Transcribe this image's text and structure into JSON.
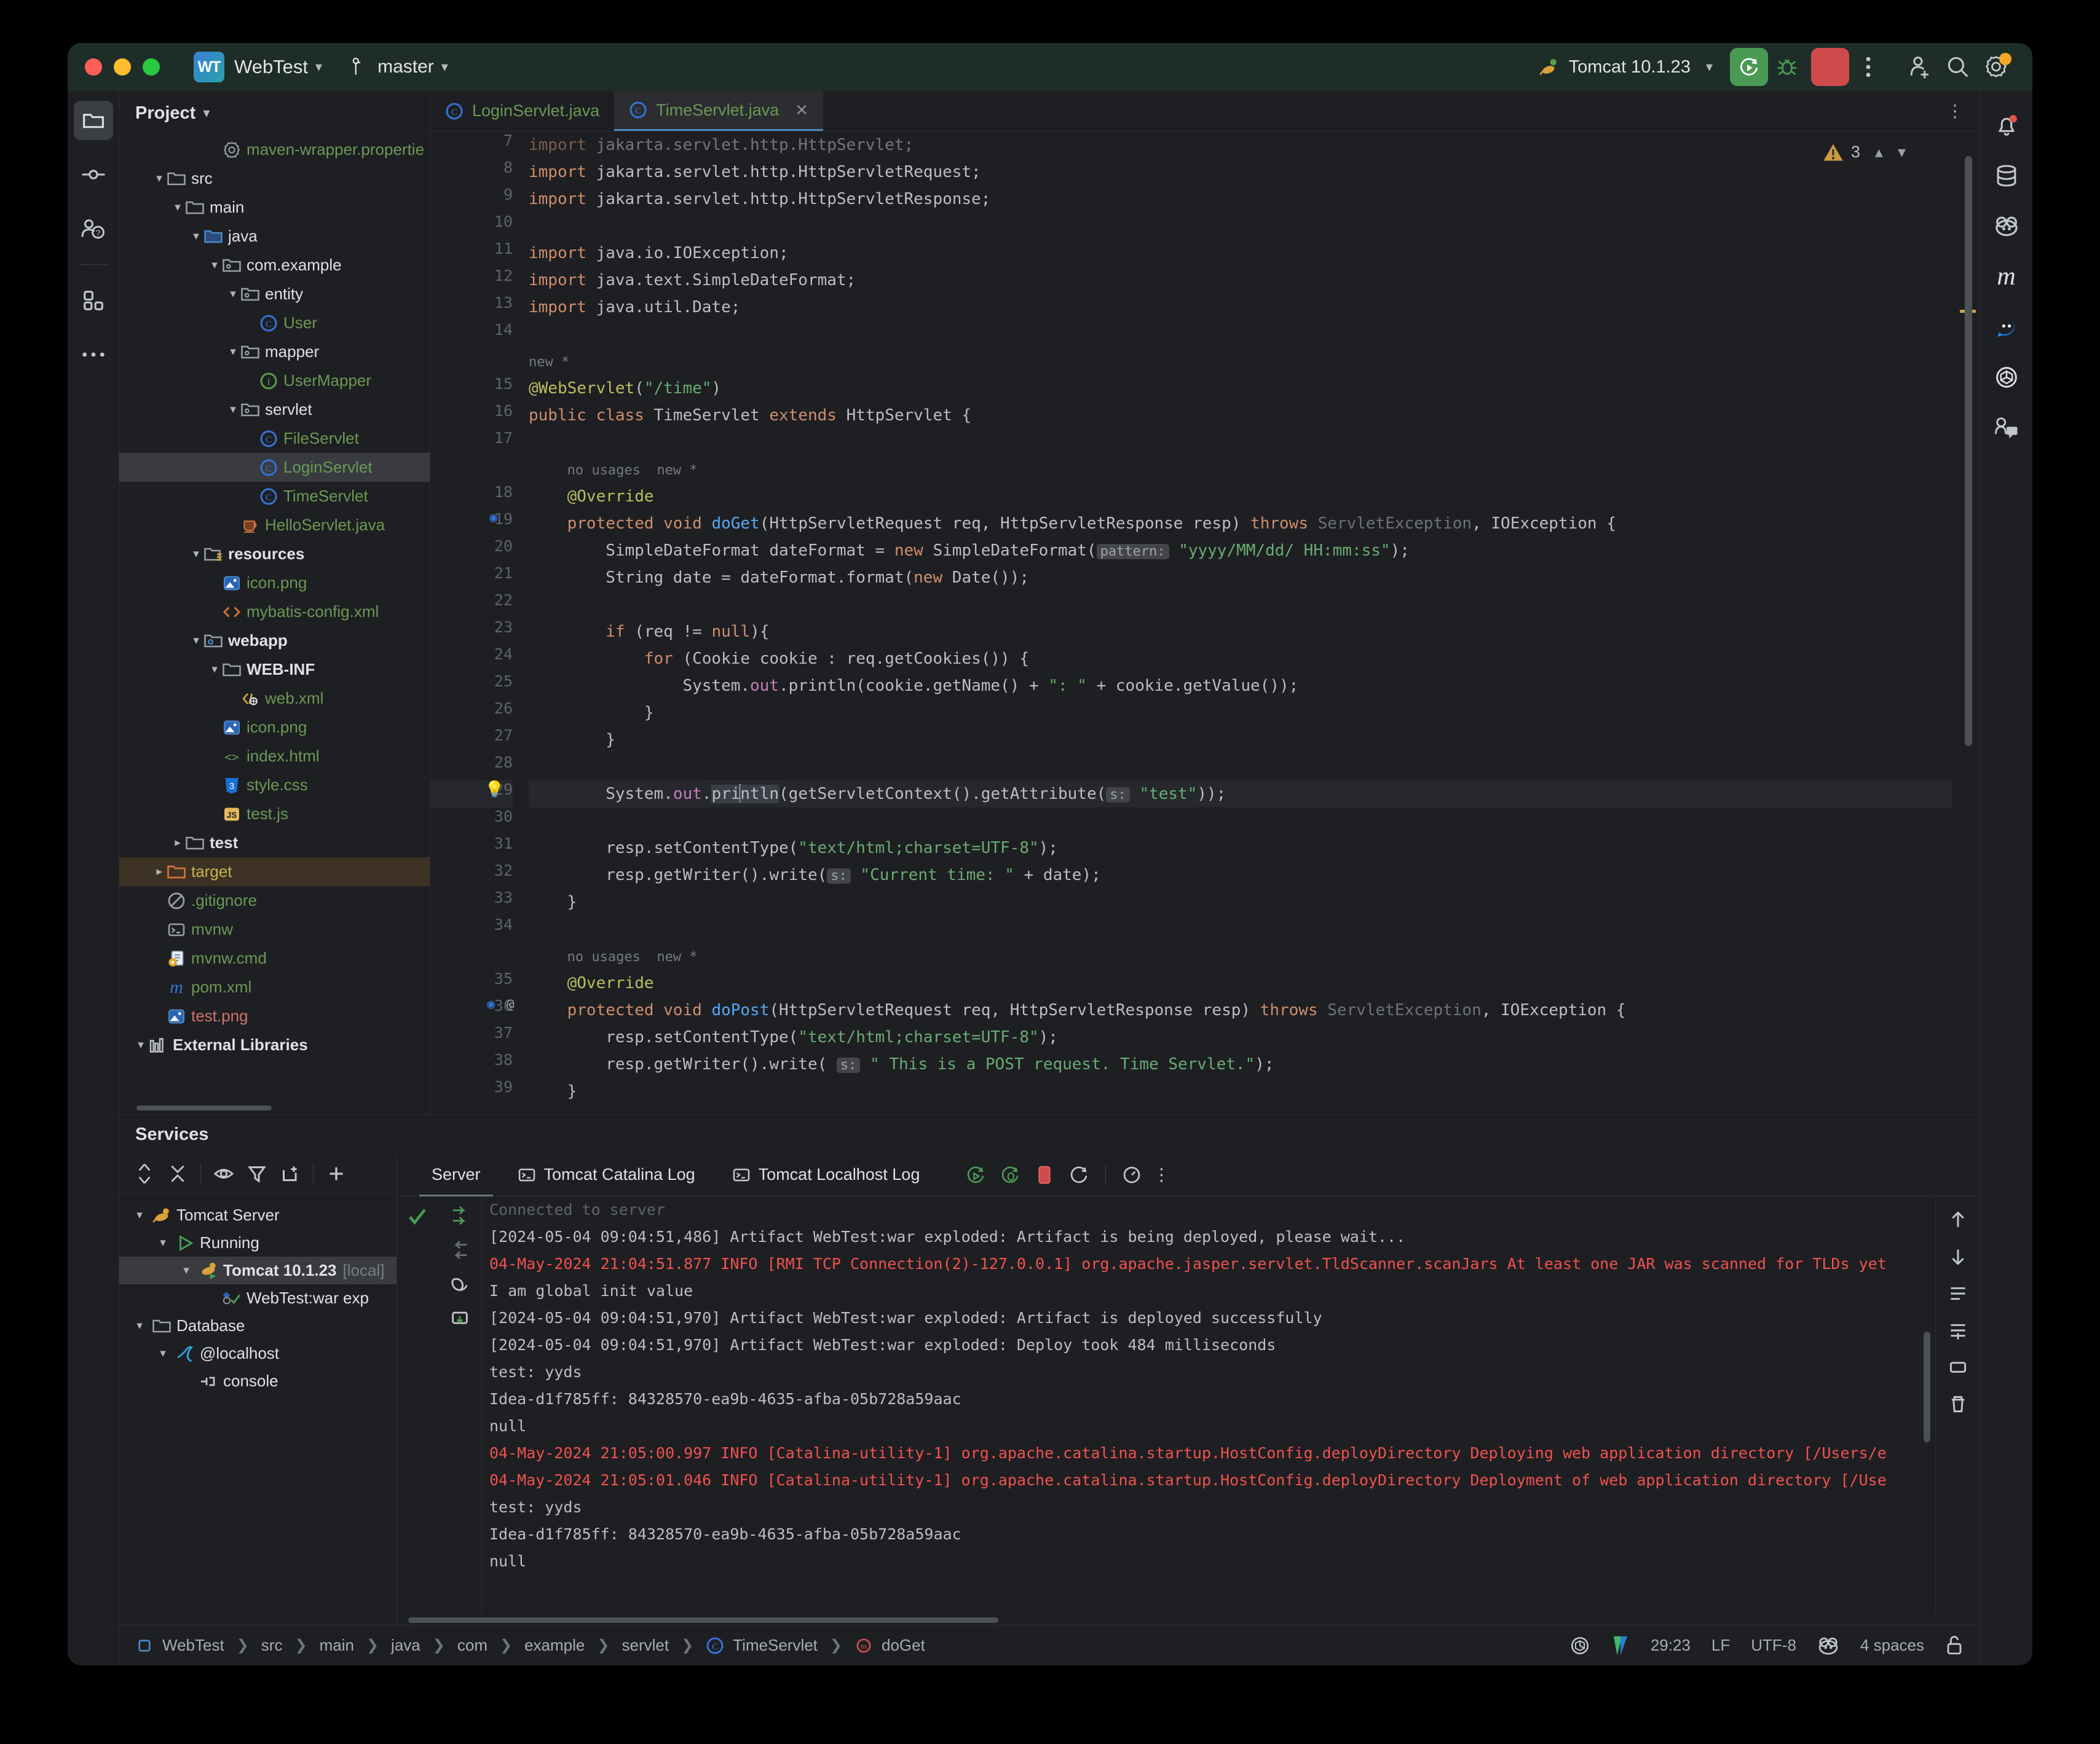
{
  "titlebar": {
    "project_badge": "WT",
    "project_name": "WebTest",
    "branch": "master",
    "run_config": "Tomcat 10.1.23",
    "icons": {
      "run": "run-icon",
      "debug": "debug-icon",
      "stop": "stop-icon",
      "more": "more-vertical-icon",
      "add_user": "add-user-icon",
      "search": "search-icon",
      "settings": "settings-icon"
    }
  },
  "left_toolbar": [
    {
      "name": "project-tool-window",
      "icon": "folder-icon",
      "active": true
    },
    {
      "name": "commit-tool-window",
      "icon": "commit-icon",
      "active": false
    },
    {
      "name": "pull-requests-tool-window",
      "icon": "pull-request-icon",
      "active": false
    },
    {
      "name": "structure-tool-window",
      "icon": "structure-icon",
      "active": false
    },
    {
      "name": "more-tool-windows",
      "icon": "ellipsis-icon",
      "active": false
    }
  ],
  "right_toolbar": [
    {
      "name": "notifications",
      "icon": "bell-icon",
      "badge": true
    },
    {
      "name": "database",
      "icon": "database-icon"
    },
    {
      "name": "github-copilot",
      "icon": "copilot-icon"
    },
    {
      "name": "maven",
      "icon": "maven-m-icon"
    },
    {
      "name": "chat",
      "icon": "chat-bubble-icon"
    },
    {
      "name": "openai-assistant",
      "icon": "openai-icon"
    },
    {
      "name": "code-with-me",
      "icon": "code-with-me-icon"
    }
  ],
  "project_panel": {
    "title": "Project",
    "tree": [
      {
        "label": "maven-wrapper.propertie",
        "indent": 4,
        "arrow": "none",
        "icon": "properties-icon",
        "color": "g"
      },
      {
        "label": "src",
        "indent": 1,
        "arrow": "open",
        "icon": "folder-icon",
        "color": "w"
      },
      {
        "label": "main",
        "indent": 2,
        "arrow": "open",
        "icon": "folder-icon",
        "color": "w"
      },
      {
        "label": "java",
        "indent": 3,
        "arrow": "open",
        "icon": "folder-source-icon",
        "color": "w"
      },
      {
        "label": "com.example",
        "indent": 4,
        "arrow": "open",
        "icon": "package-icon",
        "color": "w"
      },
      {
        "label": "entity",
        "indent": 5,
        "arrow": "open",
        "icon": "package-icon",
        "color": "w"
      },
      {
        "label": "User",
        "indent": 6,
        "arrow": "none",
        "icon": "class-icon",
        "color": "g"
      },
      {
        "label": "mapper",
        "indent": 5,
        "arrow": "open",
        "icon": "package-icon",
        "color": "w"
      },
      {
        "label": "UserMapper",
        "indent": 6,
        "arrow": "none",
        "icon": "interface-icon",
        "color": "g"
      },
      {
        "label": "servlet",
        "indent": 5,
        "arrow": "open",
        "icon": "package-icon",
        "color": "w"
      },
      {
        "label": "FileServlet",
        "indent": 6,
        "arrow": "none",
        "icon": "class-icon",
        "color": "g"
      },
      {
        "label": "LoginServlet",
        "indent": 6,
        "arrow": "none",
        "icon": "class-icon",
        "color": "g",
        "selected": true
      },
      {
        "label": "TimeServlet",
        "indent": 6,
        "arrow": "none",
        "icon": "class-icon",
        "color": "g"
      },
      {
        "label": "HelloServlet.java",
        "indent": 5,
        "arrow": "none",
        "icon": "java-file-icon",
        "color": "g"
      },
      {
        "label": "resources",
        "indent": 3,
        "arrow": "open",
        "icon": "resources-folder-icon",
        "color": "w",
        "bold": true
      },
      {
        "label": "icon.png",
        "indent": 4,
        "arrow": "none",
        "icon": "image-icon",
        "color": "g"
      },
      {
        "label": "mybatis-config.xml",
        "indent": 4,
        "arrow": "none",
        "icon": "xml-icon",
        "color": "g"
      },
      {
        "label": "webapp",
        "indent": 3,
        "arrow": "open",
        "icon": "webapp-folder-icon",
        "color": "w",
        "bold": true
      },
      {
        "label": "WEB-INF",
        "indent": 4,
        "arrow": "open",
        "icon": "folder-icon",
        "color": "w",
        "bold": true
      },
      {
        "label": "web.xml",
        "indent": 5,
        "arrow": "none",
        "icon": "web-xml-icon",
        "color": "g"
      },
      {
        "label": "icon.png",
        "indent": 4,
        "arrow": "none",
        "icon": "image-icon",
        "color": "g"
      },
      {
        "label": "index.html",
        "indent": 4,
        "arrow": "none",
        "icon": "html-icon",
        "color": "g"
      },
      {
        "label": "style.css",
        "indent": 4,
        "arrow": "none",
        "icon": "css-icon",
        "color": "g"
      },
      {
        "label": "test.js",
        "indent": 4,
        "arrow": "none",
        "icon": "js-icon",
        "color": "g"
      },
      {
        "label": "test",
        "indent": 2,
        "arrow": "closed",
        "icon": "folder-icon",
        "color": "w",
        "bold": true
      },
      {
        "label": "target",
        "indent": 1,
        "arrow": "closed",
        "icon": "excluded-folder-icon",
        "color": "yl",
        "target": true
      },
      {
        "label": ".gitignore",
        "indent": 1,
        "arrow": "none",
        "icon": "gitignore-icon",
        "color": "g"
      },
      {
        "label": "mvnw",
        "indent": 1,
        "arrow": "none",
        "icon": "terminal-file-icon",
        "color": "g"
      },
      {
        "label": "mvnw.cmd",
        "indent": 1,
        "arrow": "none",
        "icon": "cmd-file-icon",
        "color": "g"
      },
      {
        "label": "pom.xml",
        "indent": 1,
        "arrow": "none",
        "icon": "maven-m-icon",
        "color": "g"
      },
      {
        "label": "test.png",
        "indent": 1,
        "arrow": "none",
        "icon": "image-icon",
        "color": "rd"
      },
      {
        "label": "External Libraries",
        "indent": 0,
        "arrow": "open",
        "icon": "libraries-icon",
        "color": "w",
        "bold": true
      }
    ]
  },
  "editor": {
    "tabs": [
      {
        "label": "LoginServlet.java",
        "icon": "class-icon",
        "active": false,
        "closable": false
      },
      {
        "label": "TimeServlet.java",
        "icon": "class-icon",
        "active": true,
        "closable": true
      }
    ],
    "warning_count": "3",
    "lines": [
      {
        "n": "7",
        "html": "<span class='kw'>import</span> jakarta.servlet.http.HttpServlet;",
        "cut": true
      },
      {
        "n": "8",
        "html": "<span class='kw'>import</span> jakarta.servlet.http.HttpServletRequest;"
      },
      {
        "n": "9",
        "html": "<span class='kw'>import</span> jakarta.servlet.http.HttpServletResponse;"
      },
      {
        "n": "10",
        "html": ""
      },
      {
        "n": "11",
        "html": "<span class='kw'>import</span> java.io.IOException;"
      },
      {
        "n": "12",
        "html": "<span class='kw'>import</span> java.text.SimpleDateFormat;"
      },
      {
        "n": "13",
        "html": "<span class='kw'>import</span> java.util.Date;"
      },
      {
        "n": "14",
        "html": ""
      },
      {
        "n": "",
        "html": "<span class='inlay'>new *</span>"
      },
      {
        "n": "15",
        "html": "<span class='ann'>@WebServlet</span>(<span class='str'>\"/time\"</span>)"
      },
      {
        "n": "16",
        "html": "<span class='kw'>public class</span> TimeServlet <span class='kw'>extends</span> HttpServlet {"
      },
      {
        "n": "17",
        "html": ""
      },
      {
        "n": "",
        "html": "    <span class='inlay'>no usages  new *</span>"
      },
      {
        "n": "18",
        "html": "    <span class='ann'>@Override</span>"
      },
      {
        "n": "19",
        "html": "    <span class='kw'>protected void</span> <span class='fn'>doGet</span>(HttpServletRequest req, HttpServletResponse resp) <span class='kw'>throws</span> <span class='err'>ServletException</span>, IOException {"
      },
      {
        "n": "20",
        "html": "        SimpleDateFormat dateFormat = <span class='kw'>new</span> SimpleDateFormat(<span class='hint'>pattern:</span> <span class='str'>\"yyyy/MM/dd/ HH:mm:ss\"</span>);"
      },
      {
        "n": "21",
        "html": "        String date = dateFormat.format(<span class='kw'>new</span> Date());"
      },
      {
        "n": "22",
        "html": ""
      },
      {
        "n": "23",
        "html": "        <span class='kw'>if</span> (req != <span class='kw'>null</span>){"
      },
      {
        "n": "24",
        "html": "            <span class='kw'>for</span> (Cookie cookie : req.getCookies()) {"
      },
      {
        "n": "25",
        "html": "                System.<span class='stat'>out</span>.println(cookie.getName() + <span class='str'>\": \"</span> + cookie.getValue());"
      },
      {
        "n": "26",
        "html": "            }"
      },
      {
        "n": "27",
        "html": "        }"
      },
      {
        "n": "28",
        "html": ""
      },
      {
        "n": "29",
        "html": "        System.<span class='stat'>out</span>.<span class='selword'>pri</span><span class='caret'></span><span class='selword'>ntln</span>(getServletContext().getAttribute(<span class='hint'>s:</span> <span class='str'>\"test\"</span>));",
        "highlight": true,
        "bulb": true
      },
      {
        "n": "30",
        "html": ""
      },
      {
        "n": "31",
        "html": "        resp.setContentType(<span class='str'>\"text/html;charset=UTF-8\"</span>);"
      },
      {
        "n": "32",
        "html": "        resp.getWriter().write(<span class='hint'>s:</span> <span class='str'>\"Current time: \"</span> + date);"
      },
      {
        "n": "33",
        "html": "    }"
      },
      {
        "n": "34",
        "html": ""
      },
      {
        "n": "",
        "html": "    <span class='inlay'>no usages  new *</span>"
      },
      {
        "n": "35",
        "html": "    <span class='ann'>@Override</span>"
      },
      {
        "n": "36",
        "html": "    <span class='kw'>protected void</span> <span class='fn'>doPost</span>(HttpServletRequest req, HttpServletResponse resp) <span class='kw'>throws</span> <span class='err'>ServletException</span>, IOException {"
      },
      {
        "n": "37",
        "html": "        resp.setContentType(<span class='str'>\"text/html;charset=UTF-8\"</span>);"
      },
      {
        "n": "38",
        "html": "        resp.getWriter().write( <span class='hint'>s:</span> <span class='str'>\" This is a POST request. Time Servlet.\"</span>);"
      },
      {
        "n": "39",
        "html": "    }"
      }
    ]
  },
  "services": {
    "title": "Services",
    "toolbar": [
      "expand-collapse-icon",
      "collapse-all-icon",
      "show-icon",
      "filter-icon",
      "new-tab-icon",
      "add-icon"
    ],
    "tree": [
      {
        "label": "Tomcat Server",
        "indent": 0,
        "arrow": "open",
        "icon": "tomcat-icon",
        "color": "w"
      },
      {
        "label": "Running",
        "indent": 1,
        "arrow": "open",
        "icon": "run-triangle-icon",
        "color": "w"
      },
      {
        "label": "Tomcat 10.1.23",
        "suffix": "[local]",
        "indent": 2,
        "arrow": "open",
        "icon": "tomcat-run-icon",
        "color": "w",
        "bold": true,
        "selected": true
      },
      {
        "label": "WebTest:war exp",
        "indent": 3,
        "arrow": "none",
        "icon": "artifact-ok-icon",
        "color": "w"
      },
      {
        "label": "Database",
        "indent": 0,
        "arrow": "open",
        "icon": "folder-icon",
        "color": "w"
      },
      {
        "label": "@localhost",
        "indent": 1,
        "arrow": "open",
        "icon": "mysql-icon",
        "color": "w"
      },
      {
        "label": "console",
        "indent": 2,
        "arrow": "none",
        "icon": "console-icon",
        "color": "w"
      }
    ],
    "console_tabs": [
      {
        "label": "Server",
        "icon": "",
        "active": true
      },
      {
        "label": "Tomcat Catalina Log",
        "icon": "terminal-icon",
        "active": false
      },
      {
        "label": "Tomcat Localhost Log",
        "icon": "terminal-icon",
        "active": false
      }
    ],
    "console_tools": [
      "rerun-icon",
      "rerun-debug-icon",
      "stop-icon",
      "restart-icon",
      "profile-icon",
      "more-vertical-icon"
    ],
    "console_lines": [
      {
        "text": "Connected to server",
        "class": "fade",
        "cut": true
      },
      {
        "text": "[2024-05-04 09:04:51,486] Artifact WebTest:war exploded: Artifact is being deployed, please wait...",
        "class": ""
      },
      {
        "text": "04-May-2024 21:04:51.877 INFO [RMI TCP Connection(2)-127.0.0.1] org.apache.jasper.servlet.TldScanner.scanJars At least one JAR was scanned for TLDs yet",
        "class": "red"
      },
      {
        "text": "I am global init value",
        "class": ""
      },
      {
        "text": "[2024-05-04 09:04:51,970] Artifact WebTest:war exploded: Artifact is deployed successfully",
        "class": ""
      },
      {
        "text": "[2024-05-04 09:04:51,970] Artifact WebTest:war exploded: Deploy took 484 milliseconds",
        "class": ""
      },
      {
        "text": "test: yyds",
        "class": ""
      },
      {
        "text": "Idea-d1f785ff: 84328570-ea9b-4635-afba-05b728a59aac",
        "class": ""
      },
      {
        "text": "null",
        "class": ""
      },
      {
        "text": "04-May-2024 21:05:00.997 INFO [Catalina-utility-1] org.apache.catalina.startup.HostConfig.deployDirectory Deploying web application directory [/Users/e",
        "class": "red"
      },
      {
        "text": "04-May-2024 21:05:01.046 INFO [Catalina-utility-1] org.apache.catalina.startup.HostConfig.deployDirectory Deployment of web application directory [/Use",
        "class": "red"
      },
      {
        "text": "test: yyds",
        "class": ""
      },
      {
        "text": "Idea-d1f785ff: 84328570-ea9b-4635-afba-05b728a59aac",
        "class": ""
      },
      {
        "text": "null",
        "class": ""
      }
    ]
  },
  "status_bar": {
    "breadcrumbs": [
      "WebTest",
      "src",
      "main",
      "java",
      "com",
      "example",
      "servlet",
      "TimeServlet",
      "doGet"
    ],
    "caret_position": "29:23",
    "line_separator": "LF",
    "encoding": "UTF-8",
    "indent": "4 spaces",
    "icons": [
      "openai-icon",
      "vim-icon",
      "copilot-icon",
      "lock-icon"
    ]
  }
}
